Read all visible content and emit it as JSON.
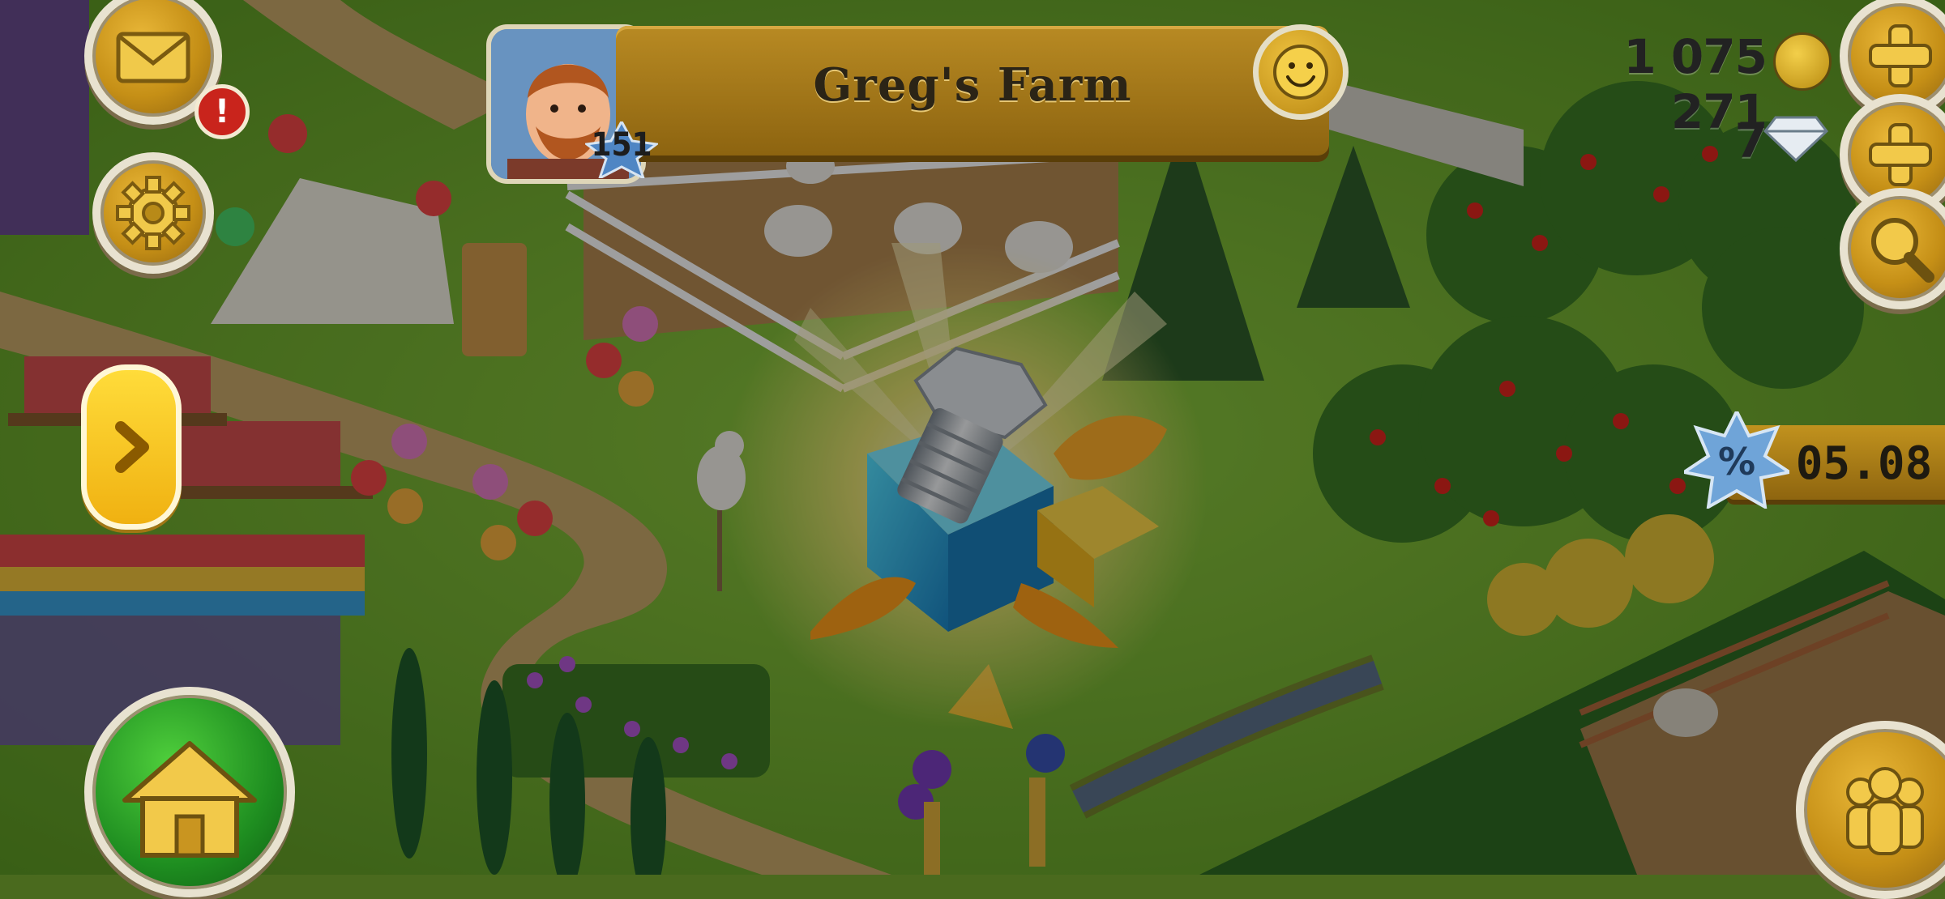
{
  "profile": {
    "farm_name": "Greg's Farm",
    "level": "151"
  },
  "currency": {
    "coins": "1 075 271",
    "diamonds": "7"
  },
  "sale": {
    "percent_symbol": "%",
    "timer": "05.08"
  },
  "notifications": {
    "mail_alert": "!"
  },
  "icons": {
    "mail": "envelope-icon",
    "settings": "gear-icon",
    "expand": "chevron-right-icon",
    "home": "house-icon",
    "friends": "people-icon",
    "add_coins": "plus-icon",
    "add_diamonds": "plus-icon",
    "search": "magnifier-icon",
    "smiley": "smiley-icon",
    "reward": "bolt-gift-icon"
  },
  "colors": {
    "hud_gold": "#c58f16",
    "hud_border": "#e8e2d0",
    "home_green": "#1e8d20",
    "alert_red": "#c9241c",
    "arrow_yellow": "#f5c21a"
  }
}
